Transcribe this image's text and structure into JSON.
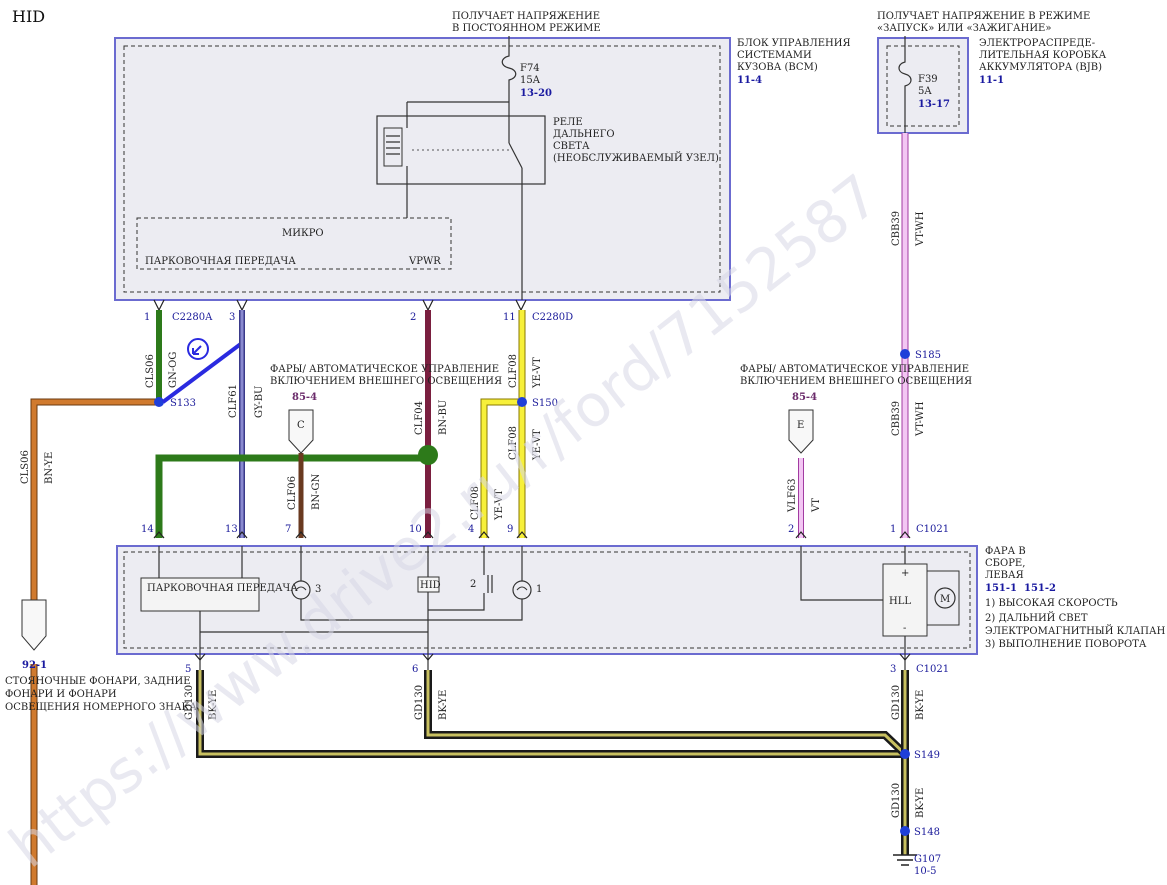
{
  "page_label": "HID",
  "top_left": {
    "line1": "ПОЛУЧАЕТ НАПРЯЖЕНИЕ",
    "line2": "В ПОСТОЯННОМ РЕЖИМЕ"
  },
  "top_right": {
    "line1": "ПОЛУЧАЕТ НАПРЯЖЕНИЕ В РЕЖИМЕ",
    "line2": "«ЗАПУСК» ИЛИ «ЗАЖИГАНИЕ»"
  },
  "bcm": {
    "line1": "БЛОК УПРАВЛЕНИЯ",
    "line2": "СИСТЕМАМИ",
    "line3": "КУЗОВА (BCM)",
    "ref": "11-4"
  },
  "bjb": {
    "line1": "ЭЛЕКТРОРАСПРЕДЕ-",
    "line2": "ЛИТЕЛЬНАЯ КОРОБКА",
    "line3": "АККУМУЛЯТОРА (BJB)",
    "ref": "11-1"
  },
  "fuse_f74": {
    "name": "F74",
    "rating": "15A",
    "ref": "13-20"
  },
  "fuse_f39": {
    "name": "F39",
    "rating": "5A",
    "ref": "13-17"
  },
  "relay": {
    "line1": "РЕЛЕ",
    "line2": "ДАЛЬНЕГО",
    "line3": "СВЕТА",
    "line4": "(НЕОБСЛУЖИВАЕМЫЙ УЗЕЛ)"
  },
  "micro": {
    "title": "МИКРО",
    "pin_park": "ПАРКОВОЧНАЯ ПЕРЕДАЧА",
    "pin_vpwr": "VPWR"
  },
  "connectors": {
    "c2280a": "C2280A",
    "c2280d": "C2280D",
    "c1021_top": "C1021",
    "c1021_bottom": "C1021"
  },
  "pins_top": {
    "p1": "1",
    "p3": "3",
    "p2": "2",
    "p11": "11"
  },
  "pins_lamp": {
    "p14": "14",
    "p13": "13",
    "p7": "7",
    "p10": "10",
    "p4": "4",
    "p9": "9",
    "p2": "2",
    "p1": "1"
  },
  "pins_bottom": {
    "p5": "5",
    "p6": "6",
    "p3": "3"
  },
  "splices": {
    "s133": "S133",
    "s150": "S150",
    "s185": "S185",
    "s149": "S149",
    "s148": "S148"
  },
  "ground": {
    "name": "G107",
    "ref": "10-5"
  },
  "wires": {
    "cls06_a": {
      "circuit": "CLS06",
      "color": "GN-OG"
    },
    "clf61": {
      "circuit": "CLF61",
      "color": "GY-BU"
    },
    "clf04": {
      "circuit": "CLF04",
      "color": "BN-BU"
    },
    "clf08_a": {
      "circuit": "CLF08",
      "color": "YE-VT"
    },
    "cbb39_a": {
      "circuit": "CBB39",
      "color": "VT-WH"
    },
    "cls06_b": {
      "circuit": "CLS06",
      "color": "BN-YE"
    },
    "clf06": {
      "circuit": "CLF06",
      "color": "BN-GN"
    },
    "clf08_b": {
      "circuit": "CLF08",
      "color": "YE-VT"
    },
    "clf08_c": {
      "circuit": "CLF08",
      "color": "YE-VT"
    },
    "vlf63": {
      "circuit": "VLF63",
      "color": "VT"
    },
    "cbb39_b": {
      "circuit": "CBB39",
      "color": "VT-WH"
    },
    "gd130_a": {
      "circuit": "GD130",
      "color": "BK-YE"
    },
    "gd130_b": {
      "circuit": "GD130",
      "color": "BK-YE"
    },
    "gd130_c": {
      "circuit": "GD130",
      "color": "BK-YE"
    },
    "gd130_d": {
      "circuit": "GD130",
      "color": "BK-YE"
    }
  },
  "headlamps_note_left": {
    "line1": "ФАРЫ/ АВТОМАТИЧЕСКОЕ УПРАВЛЕНИЕ",
    "line2": "ВКЛЮЧЕНИЕМ ВНЕШНЕГО ОСВЕЩЕНИЯ",
    "ref": "85-4",
    "tag": "C"
  },
  "headlamps_note_right": {
    "line1": "ФАРЫ/ АВТОМАТИЧЕСКОЕ УПРАВЛЕНИЕ",
    "line2": "ВКЛЮЧЕНИЕМ ВНЕШНЕГО ОСВЕЩЕНИЯ",
    "ref": "85-4",
    "tag": "E"
  },
  "parking_note": {
    "ref": "92-1",
    "line1": "СТОЯНОЧНЫЕ ФОНАРИ, ЗАДНИЕ",
    "line2": "ФОНАРИ И ФОНАРИ",
    "line3": "ОСВЕЩЕНИЯ НОМЕРНОГО ЗНАКА"
  },
  "lamp": {
    "line1": "ФАРА В",
    "line2": "СБОРЕ,",
    "line3": "ЛЕВАЯ",
    "ref1": "151-1",
    "ref2": "151-2",
    "item1": "1) ВЫСОКАЯ СКОРОСТЬ",
    "item2": "2) ДАЛЬНИЙ СВЕТ",
    "item2b": "ЭЛЕКТРОМАГНИТНЫЙ КЛАПАН",
    "item3": "3) ВЫПОЛНЕНИЕ ПОВОРОТА",
    "park_box": "ПАРКОВОЧНАЯ ПЕРЕДАЧА",
    "hid": "HID",
    "hll": "HLL",
    "motor": "M",
    "plus": "+",
    "minus": "-",
    "bulb3": "3",
    "coil2": "2",
    "bulb1": "1"
  },
  "watermark": "https://www.drive2.ru/r/ford/7152587"
}
